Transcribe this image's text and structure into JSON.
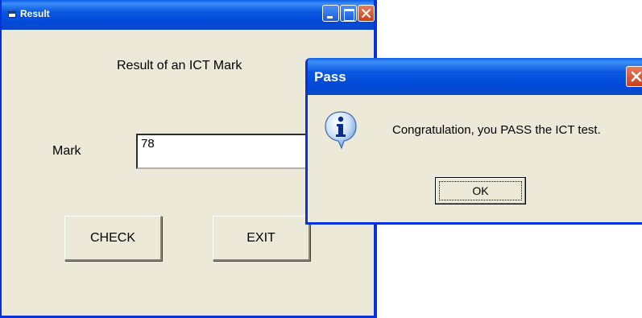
{
  "result_window": {
    "title": "Result",
    "heading": "Result of an ICT Mark",
    "mark_label": "Mark",
    "mark_value": "78",
    "check_label": "CHECK",
    "exit_label": "EXIT"
  },
  "pass_dialog": {
    "title": "Pass",
    "message": "Congratulation, you  PASS the ICT test.",
    "ok_label": "OK",
    "icon": "info-icon"
  },
  "colors": {
    "titlebar": "#0a58e0",
    "window_face": "#ece9d8",
    "close_button": "#c9411e"
  }
}
